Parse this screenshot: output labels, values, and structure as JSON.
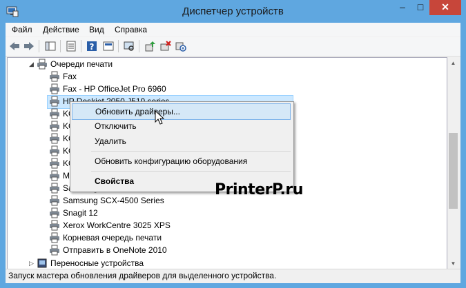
{
  "window": {
    "title": "Диспетчер устройств",
    "controls": {
      "minimize": "–",
      "maximize": "□",
      "close": "✕"
    },
    "accent": "#5fa7e0"
  },
  "menu": [
    "Файл",
    "Действие",
    "Вид",
    "Справка"
  ],
  "toolbar_icons": [
    "back-arrow-icon",
    "forward-arrow-icon",
    "show-hide-console-tree-icon",
    "properties-icon",
    "help-icon",
    "device-properties-icon",
    "update-driver-icon",
    "uninstall-device-icon",
    "scan-hardware-icon"
  ],
  "tree": {
    "category": "Очереди печати",
    "items": [
      "Fax",
      "Fax - HP OfficeJet Pro 6960",
      "HP Deskjet 2050 J510 series",
      "KONICA MINOLTA",
      "KONICA MINOLTA",
      "KONICA MINOLTA",
      "KONICA MINOLTA",
      "KONICA MINOLTA",
      "Microsoft XPS Document Writer",
      "Samsung SCX-4500 Series",
      "Samsung SCX-4500 Series",
      "Snagit 12",
      "Xerox WorkCentre 3025 XPS",
      "Корневая очередь печати",
      "Отправить в OneNote 2010"
    ],
    "next_category": "Переносные устройства"
  },
  "context_menu": {
    "update_drivers": "Обновить драйверы...",
    "disable": "Отключить",
    "delete": "Удалить",
    "scan": "Обновить конфигурацию оборудования",
    "properties": "Свойства"
  },
  "status_text": "Запуск мастера обновления драйверов для выделенного устройства.",
  "watermark": "PrinterP.ru"
}
